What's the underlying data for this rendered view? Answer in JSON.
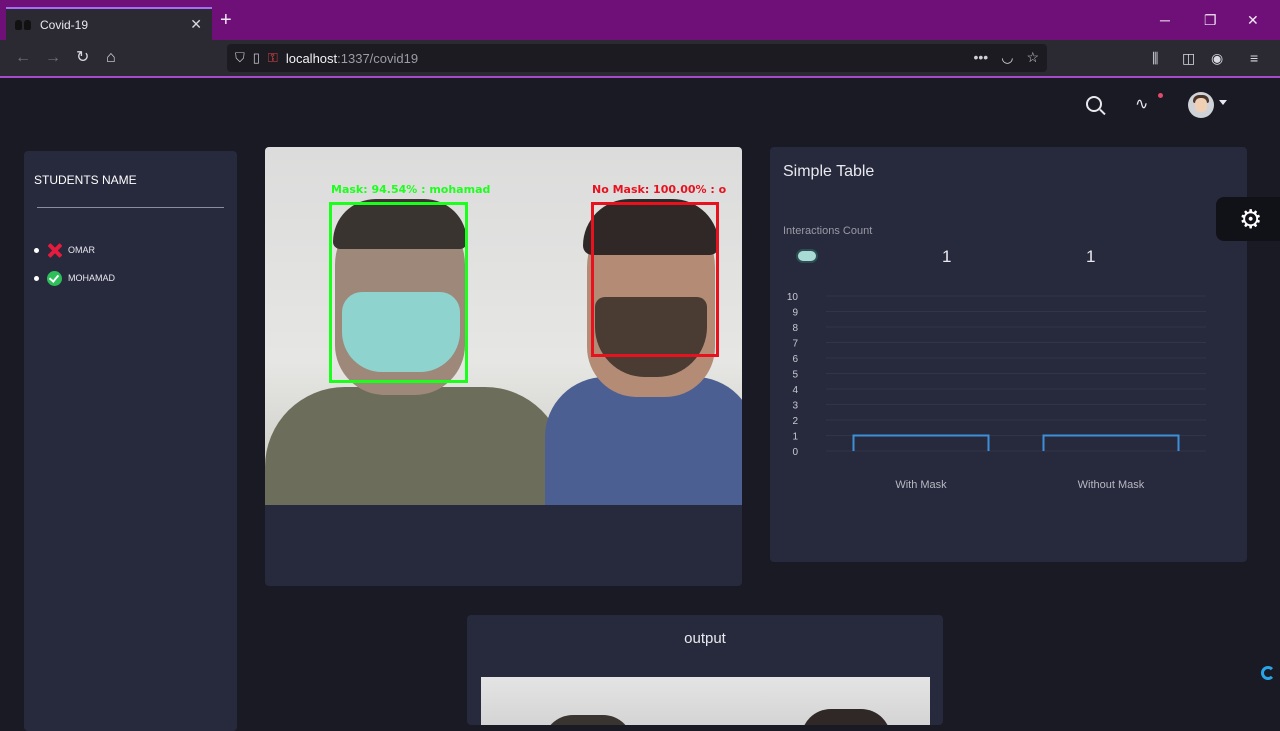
{
  "browser": {
    "tab_title": "Covid-19",
    "tab_close": "✕",
    "new_tab": "+",
    "url_host": "localhost",
    "url_path": ":1337/covid19",
    "minimize": "─",
    "restore": "❐",
    "close": "✕",
    "more": "•••"
  },
  "sidebar": {
    "title": "STUDENTS NAME",
    "students": [
      {
        "name": "OMAR",
        "status": "no-mask"
      },
      {
        "name": "MOHAMAD",
        "status": "mask"
      }
    ]
  },
  "video": {
    "detections": [
      {
        "label": "Mask: 94.54% : mohamad",
        "color": "#1cff1c"
      },
      {
        "label": "No Mask: 100.00% : o",
        "color": "#e8121e"
      }
    ]
  },
  "chart_panel": {
    "title": "Simple Table",
    "subtitle": "Interactions Count",
    "counts": [
      "1",
      "1"
    ]
  },
  "chart_data": {
    "type": "bar",
    "categories": [
      "With Mask",
      "Without Mask"
    ],
    "values": [
      1,
      1
    ],
    "ylim": [
      0,
      10
    ],
    "yticks": [
      "0",
      "1",
      "2",
      "3",
      "4",
      "5",
      "6",
      "7",
      "8",
      "9",
      "10"
    ],
    "grid": true,
    "bar_color": "#3d8fd6"
  },
  "output": {
    "title": "output"
  },
  "colors": {
    "accent": "#6f0f78",
    "panel": "#27293d",
    "page": "#1a1a24"
  }
}
